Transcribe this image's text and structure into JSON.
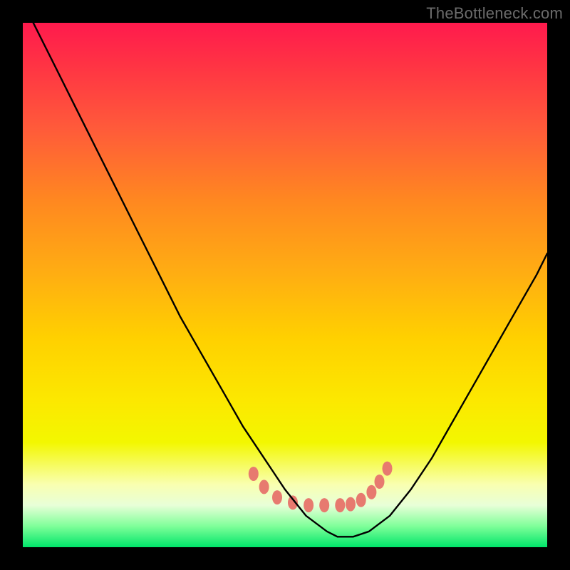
{
  "watermark": {
    "text": "TheBottleneck.com"
  },
  "chart_data": {
    "type": "line",
    "title": "",
    "xlabel": "",
    "ylabel": "",
    "xlim": [
      0,
      100
    ],
    "ylim": [
      0,
      100
    ],
    "grid": false,
    "legend": false,
    "series": [
      {
        "name": "bottleneck-curve",
        "x": [
          2,
          6,
          10,
          14,
          18,
          22,
          26,
          30,
          34,
          38,
          42,
          46,
          50,
          54,
          58,
          60,
          63,
          66,
          70,
          74,
          78,
          82,
          86,
          90,
          94,
          98,
          100
        ],
        "y": [
          100,
          92,
          84,
          76,
          68,
          60,
          52,
          44,
          37,
          30,
          23,
          17,
          11,
          6,
          3,
          2,
          2,
          3,
          6,
          11,
          17,
          24,
          31,
          38,
          45,
          52,
          56
        ]
      }
    ],
    "markers": {
      "name": "bottleneck-markers",
      "x": [
        44,
        46,
        48.5,
        51.5,
        54.5,
        57.5,
        60.5,
        62.5,
        64.5,
        66.5,
        68,
        69.5
      ],
      "y": [
        14,
        11.5,
        9.5,
        8.5,
        8,
        8,
        8,
        8.2,
        9,
        10.5,
        12.5,
        15
      ],
      "color": "#e77a6f",
      "rx": 7,
      "ry": 10
    },
    "gradient_stops": [
      {
        "pos": 0,
        "color": "#ff1a4d"
      },
      {
        "pos": 20,
        "color": "#ff5a3a"
      },
      {
        "pos": 48,
        "color": "#ffae12"
      },
      {
        "pos": 72,
        "color": "#fce800"
      },
      {
        "pos": 92,
        "color": "#e8ffd8"
      },
      {
        "pos": 100,
        "color": "#00e56a"
      }
    ]
  }
}
